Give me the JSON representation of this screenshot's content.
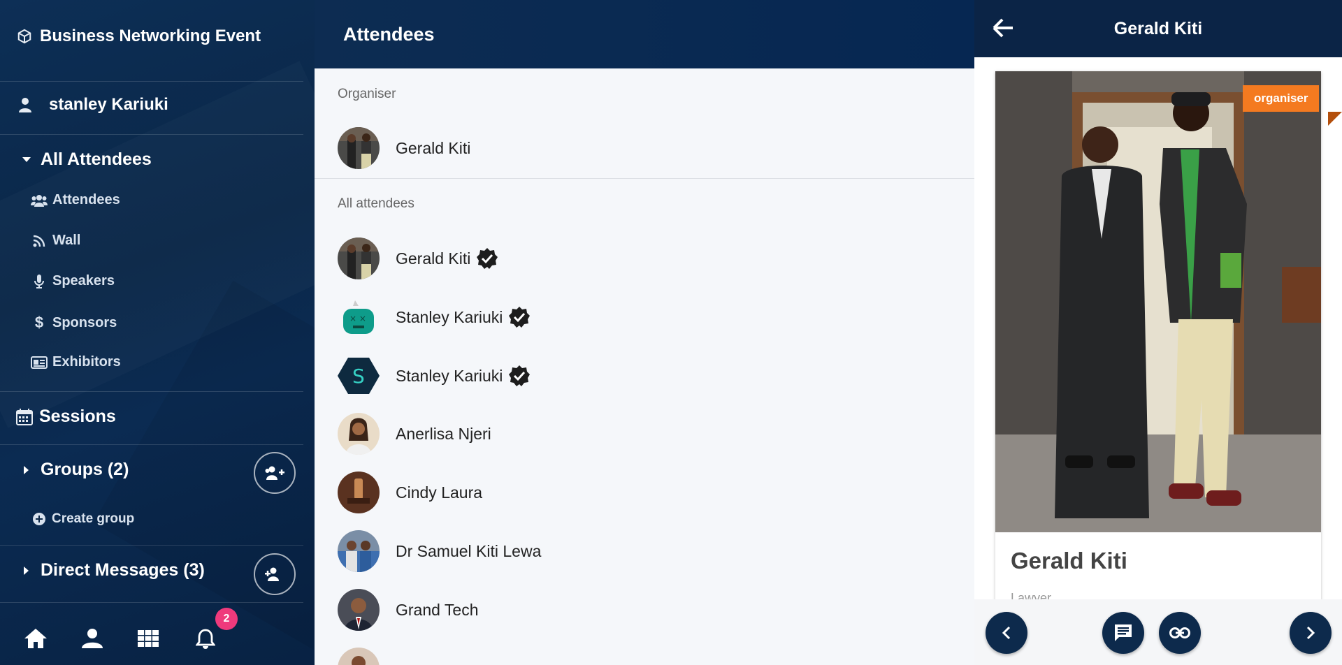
{
  "sidebar": {
    "event_title": "Business Networking Event",
    "user_name": "stanley Kariuki",
    "all_attendees_label": "All Attendees",
    "sub_items": [
      {
        "label": "Attendees",
        "icon": "users-icon"
      },
      {
        "label": "Wall",
        "icon": "rss-icon"
      },
      {
        "label": "Speakers",
        "icon": "microphone-icon"
      },
      {
        "label": "Sponsors",
        "icon": "dollar-icon"
      },
      {
        "label": "Exhibitors",
        "icon": "id-card-icon"
      }
    ],
    "sessions_label": "Sessions",
    "groups_label": "Groups (2)",
    "create_group_label": "Create group",
    "direct_messages_label": "Direct Messages (3)",
    "notification_count": "2"
  },
  "middle": {
    "header_title": "Attendees",
    "organiser_label": "Organiser",
    "organiser_name": "Gerald Kiti",
    "all_attendees_label": "All attendees",
    "attendees": [
      {
        "name": "Gerald Kiti",
        "verified": true
      },
      {
        "name": "Stanley Kariuki",
        "verified": true
      },
      {
        "name": "Stanley Kariuki",
        "verified": true
      },
      {
        "name": "Anerlisa Njeri",
        "verified": false
      },
      {
        "name": "Cindy Laura",
        "verified": false
      },
      {
        "name": "Dr Samuel Kiti Lewa",
        "verified": false
      },
      {
        "name": "Grand Tech",
        "verified": false
      }
    ]
  },
  "profile": {
    "header_title": "Gerald Kiti",
    "badge": "organiser",
    "name": "Gerald Kiti",
    "role": "Lawyer"
  },
  "colors": {
    "sidebar_bg": "#0a2647",
    "header_bg": "#062752",
    "badge_orange": "#f47a20",
    "notification_pink": "#ef3a7c"
  }
}
